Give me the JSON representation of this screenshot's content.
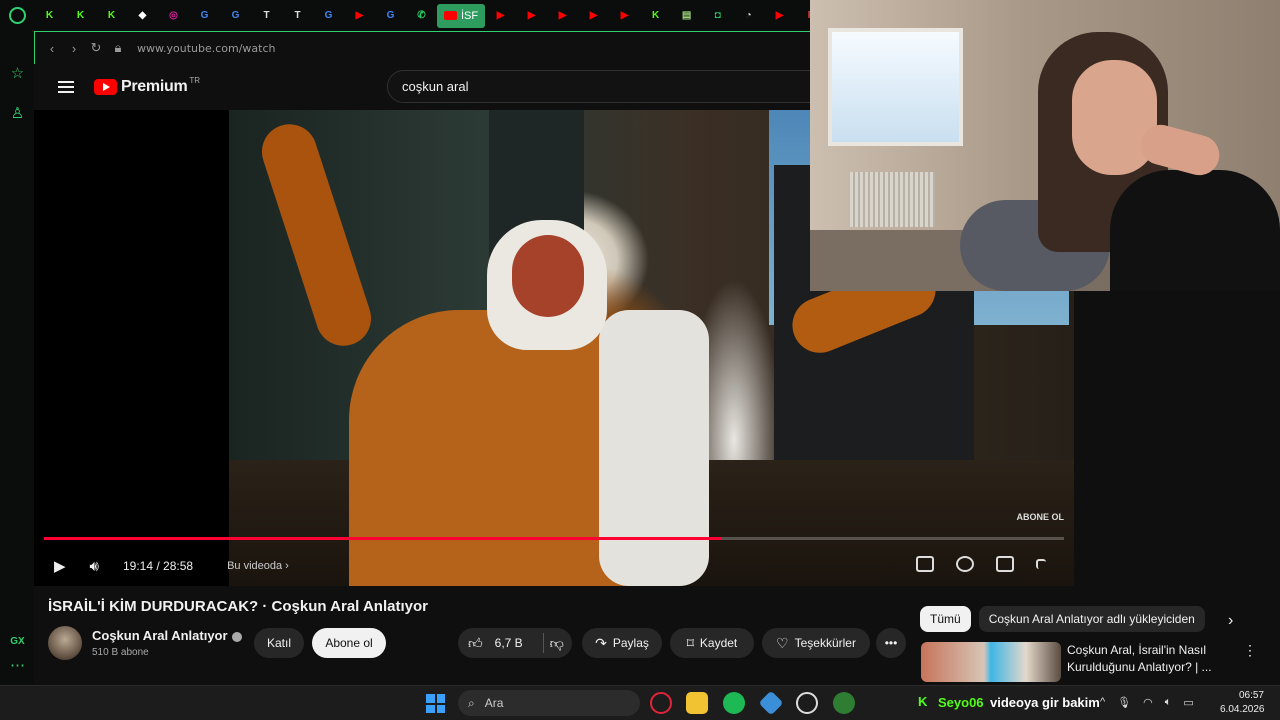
{
  "browser": {
    "address": "www.youtube.com/watch",
    "active_tab_label": "İSF",
    "bookmarks": [
      {
        "icon": "kick-icon",
        "color": "#53fc18",
        "glyph": "K"
      },
      {
        "icon": "kick-icon",
        "color": "#53fc18",
        "glyph": "K"
      },
      {
        "icon": "kick-icon",
        "color": "#53fc18",
        "glyph": "K"
      },
      {
        "icon": "app-icon",
        "color": "#ffffff",
        "glyph": "◆"
      },
      {
        "icon": "instagram-icon",
        "color": "#d6249f",
        "glyph": "◎"
      },
      {
        "icon": "google-icon",
        "color": "#4285f4",
        "glyph": "G"
      },
      {
        "icon": "google-icon",
        "color": "#4285f4",
        "glyph": "G"
      },
      {
        "icon": "tv-icon",
        "color": "#dddddd",
        "glyph": "T"
      },
      {
        "icon": "tv-icon",
        "color": "#dddddd",
        "glyph": "T"
      },
      {
        "icon": "google-icon",
        "color": "#4285f4",
        "glyph": "G"
      },
      {
        "icon": "youtube-icon",
        "color": "#ff0000",
        "glyph": "▶"
      },
      {
        "icon": "google-icon",
        "color": "#4285f4",
        "glyph": "G"
      },
      {
        "icon": "whatsapp-icon",
        "color": "#25d366",
        "glyph": "✆"
      }
    ],
    "bookmarks_after": [
      {
        "icon": "youtube-icon",
        "color": "#ff0000",
        "glyph": "▶"
      },
      {
        "icon": "youtube-icon",
        "color": "#ff0000",
        "glyph": "▶"
      },
      {
        "icon": "youtube-icon",
        "color": "#ff0000",
        "glyph": "▶"
      },
      {
        "icon": "youtube-icon",
        "color": "#ff0000",
        "glyph": "▶"
      },
      {
        "icon": "youtube-icon",
        "color": "#ff0000",
        "glyph": "▶"
      },
      {
        "icon": "kick-icon",
        "color": "#53fc18",
        "glyph": "K"
      },
      {
        "icon": "doc-icon",
        "color": "#9ad27a",
        "glyph": "▤"
      },
      {
        "icon": "app-icon",
        "color": "#2fd06f",
        "glyph": "◘"
      },
      {
        "icon": "app-icon",
        "color": "#dddddd",
        "glyph": "◔"
      },
      {
        "icon": "youtube-icon",
        "color": "#ff0000",
        "glyph": "▶"
      },
      {
        "icon": "app-icon",
        "color": "#e03a3a",
        "glyph": "F"
      },
      {
        "icon": "youtube-icon",
        "color": "#ff0000",
        "glyph": "▶"
      }
    ]
  },
  "youtube": {
    "logo_text": "Premium",
    "country_code": "TR",
    "search_value": "coşkun aral"
  },
  "player": {
    "time": "19:14 / 28:58",
    "chapter": "Bu videoda",
    "progress": 0.664,
    "watermark": "ABONE OL"
  },
  "video": {
    "title": "İSRAİL'İ KİM DURDURACAK? · Coşkun Aral Anlatıyor",
    "channel": "Coşkun Aral Anlatıyor",
    "subscribers": "510 B abone",
    "join_label": "Katıl",
    "subscribe_label": "Abone ol",
    "likes": "6,7 B",
    "share_label": "Paylaş",
    "save_label": "Kaydet",
    "thanks_label": "Teşekkürler",
    "more_label": "•••"
  },
  "recommendations": {
    "chips": [
      "Tümü",
      "Coşkun Aral Anlatıyor adlı yükleyiciden"
    ],
    "item_title": "Coşkun Aral, İsrail'in Nasıl Kurulduğunu Anlatıyor? | ..."
  },
  "taskbar": {
    "search_placeholder": "Ara",
    "kick_user": "Seyo06",
    "kick_message": "videoya gir bakim",
    "time": "06:57",
    "date": "6.04.2026"
  },
  "sidebar_bottom": "GX"
}
